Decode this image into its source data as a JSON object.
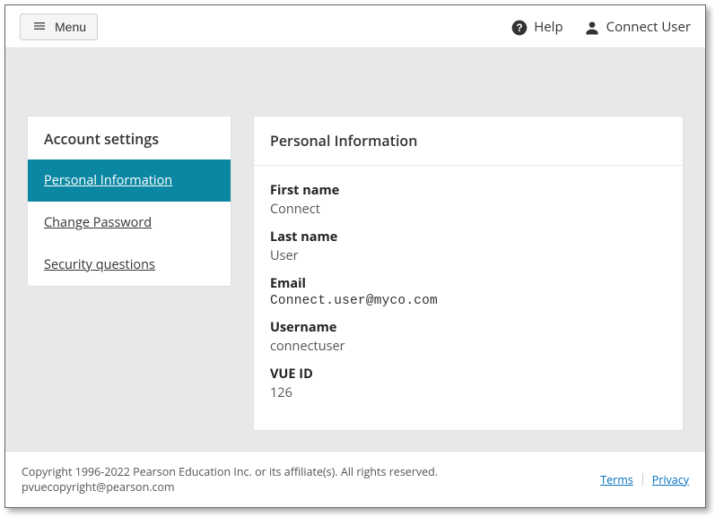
{
  "topbar": {
    "menu_label": "Menu",
    "help_label": "Help",
    "user_label": "Connect User"
  },
  "sidebar": {
    "title": "Account settings",
    "items": [
      {
        "label": "Personal Information",
        "active": true
      },
      {
        "label": "Change Password",
        "active": false
      },
      {
        "label": "Security questions",
        "active": false
      }
    ]
  },
  "panel": {
    "title": "Personal Information",
    "fields": {
      "first_name": {
        "label": "First name",
        "value": "Connect"
      },
      "last_name": {
        "label": "Last name",
        "value": "User"
      },
      "email": {
        "label": "Email",
        "value": "Connect.user@myco.com"
      },
      "username": {
        "label": "Username",
        "value": "connectuser"
      },
      "vue_id": {
        "label": "VUE ID",
        "value": "126"
      }
    }
  },
  "footer": {
    "copyright": "Copyright 1996-2022 Pearson Education Inc. or its affiliate(s). All rights reserved. pvuecopyright@pearson.com",
    "terms_label": "Terms",
    "privacy_label": "Privacy"
  }
}
